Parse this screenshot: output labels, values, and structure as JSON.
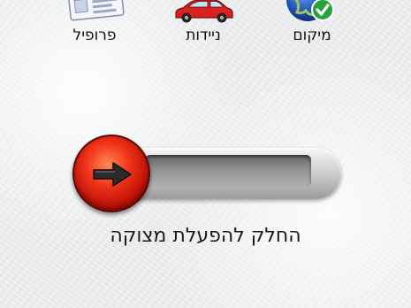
{
  "nav": {
    "items": [
      {
        "id": "profile",
        "label": "פרופיל",
        "icon": "profile-card-icon"
      },
      {
        "id": "mobility",
        "label": "ניידות",
        "icon": "car-icon"
      },
      {
        "id": "location",
        "label": "מיקום",
        "icon": "globe-check-icon"
      }
    ]
  },
  "slider": {
    "instruction": "החלק להפעלת מצוקה",
    "knob_icon": "arrow-right-icon",
    "position": 0
  },
  "colors": {
    "knob": "#e02a12",
    "track": "#b8b8b8",
    "car": "#d9221f",
    "globe": "#1f55b5",
    "check": "#27a33a"
  }
}
